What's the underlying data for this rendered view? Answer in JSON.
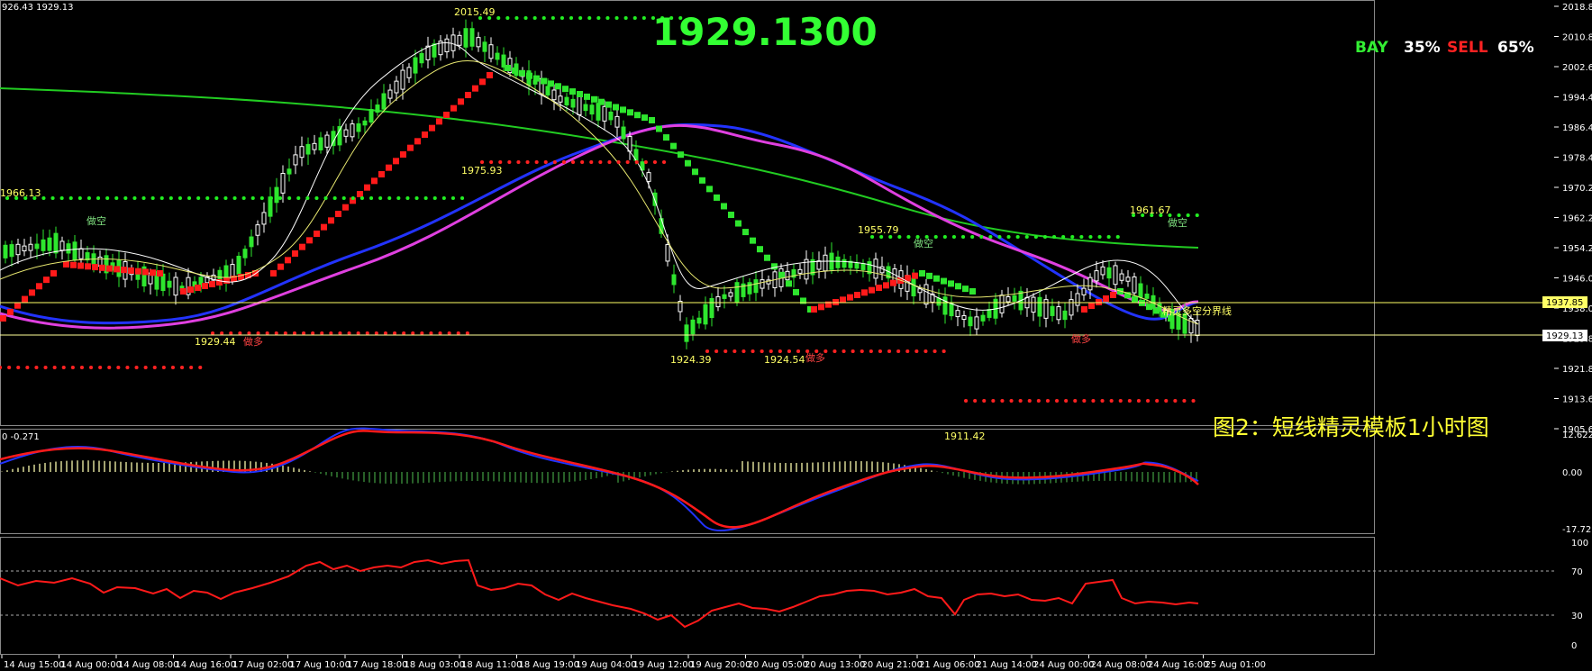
{
  "header": {
    "corner_info": "926.43 1929.13",
    "big_price": "1929.1300",
    "bay_label": "BAY",
    "bay_value": "35%",
    "sell_label": "SELL",
    "sell_value": "65%",
    "caption": "图2：短线精灵模板1小时图",
    "divider_label": "精灵多空分界线"
  },
  "colors": {
    "background": "#000000",
    "bull_green": "#2ee62e",
    "bear_red": "#ff1a1a",
    "price_yellow": "#ffff66",
    "ma_blue": "#1f3cff",
    "ma_magenta": "#e040e0",
    "ma_green": "#22cc22",
    "caption_yellow": "#ffff33",
    "axis_text": "#ffffff"
  },
  "price_axis": {
    "ticks": [
      "2018.80",
      "2010.80",
      "2002.60",
      "1994.40",
      "1986.40",
      "1978.40",
      "1970.20",
      "1962.20",
      "1954.20",
      "1946.00",
      "1938.00",
      "1929.80",
      "1921.80",
      "1913.60",
      "1905.60"
    ],
    "marker_upper": "1937.85",
    "marker_lower": "1929.13"
  },
  "macd_axis": {
    "ticks": [
      "12.622",
      "0.00",
      "-17.723"
    ],
    "info": "0 -0.271"
  },
  "rsi_axis": {
    "ticks": [
      "100",
      "70",
      "30",
      "0"
    ]
  },
  "time_axis": {
    "labels": [
      "14 Aug 15:00",
      "14 Aug 00:00",
      "14 Aug 08:00",
      "14 Aug 16:00",
      "17 Aug 02:00",
      "17 Aug 10:00",
      "17 Aug 18:00",
      "18 Aug 03:00",
      "18 Aug 11:00",
      "18 Aug 19:00",
      "19 Aug 04:00",
      "19 Aug 12:00",
      "19 Aug 20:00",
      "20 Aug 05:00",
      "20 Aug 13:00",
      "20 Aug 21:00",
      "21 Aug 06:00",
      "21 Aug 14:00",
      "24 Aug 00:00",
      "24 Aug 08:00",
      "24 Aug 16:00",
      "25 Aug 01:00"
    ]
  },
  "annotations": {
    "levels": [
      "2015.49",
      "1975.93",
      "1966.13",
      "1929.44",
      "1924.39",
      "1924.54",
      "1955.79",
      "1911.42",
      "1961.67"
    ],
    "signals": [
      "做空",
      "做多"
    ]
  }
}
